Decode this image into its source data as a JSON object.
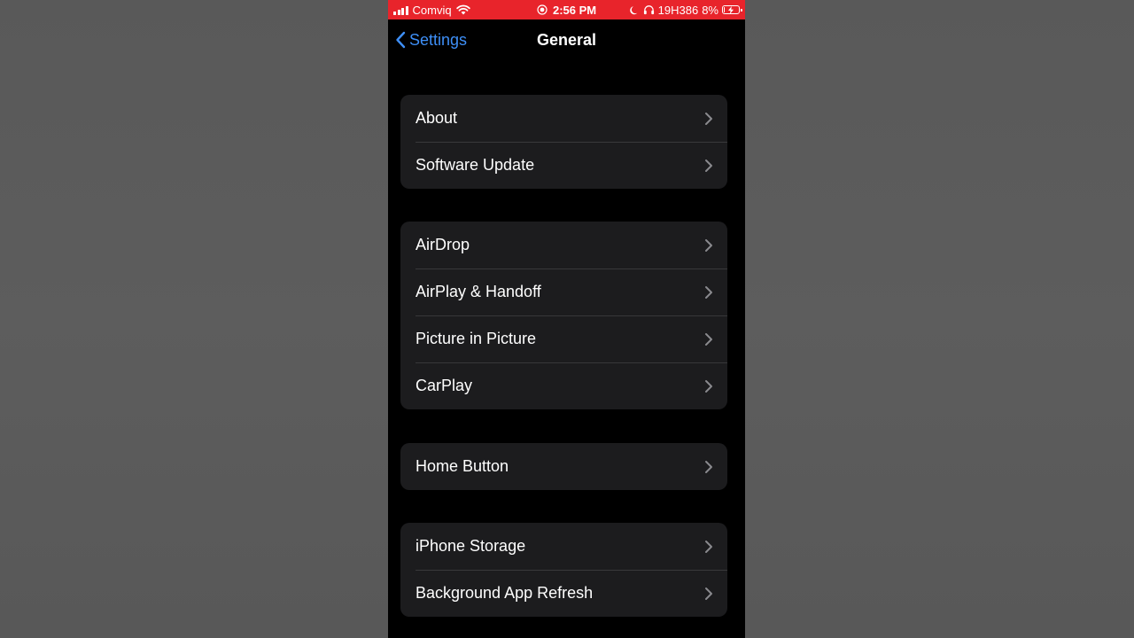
{
  "status_bar": {
    "carrier": "Comviq",
    "time": "2:56 PM",
    "device": "19H386",
    "battery_percent": "8%",
    "battery_level": 0.08,
    "icons": [
      "signal-icon",
      "wifi-icon",
      "screen-record-icon",
      "moon-icon",
      "headphones-icon",
      "battery-charging-icon"
    ],
    "background_color": "#e8242b"
  },
  "nav": {
    "back_label": "Settings",
    "title": "General",
    "accent_color": "#3e8ff7"
  },
  "groups": [
    {
      "items": [
        {
          "label": "About"
        },
        {
          "label": "Software Update"
        }
      ]
    },
    {
      "items": [
        {
          "label": "AirDrop"
        },
        {
          "label": "AirPlay & Handoff"
        },
        {
          "label": "Picture in Picture"
        },
        {
          "label": "CarPlay"
        }
      ]
    },
    {
      "items": [
        {
          "label": "Home Button"
        }
      ]
    },
    {
      "items": [
        {
          "label": "iPhone Storage"
        },
        {
          "label": "Background App Refresh"
        }
      ]
    }
  ]
}
